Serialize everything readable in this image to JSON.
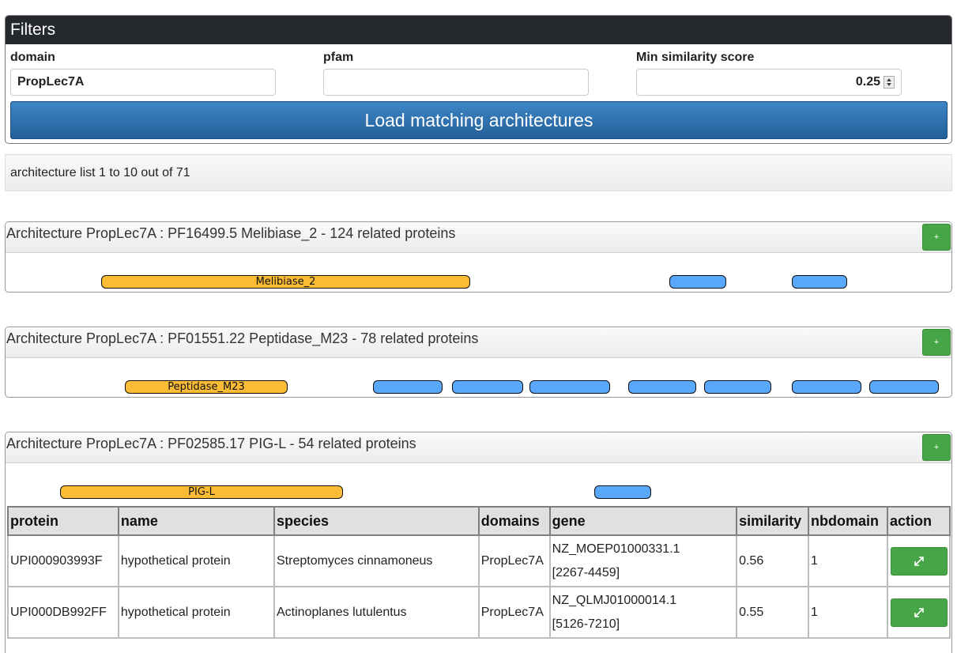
{
  "filters": {
    "title": "Filters",
    "domain": {
      "label": "domain",
      "value": "PropLec7A"
    },
    "pfam": {
      "label": "pfam",
      "value": ""
    },
    "min_similarity": {
      "label": "Min similarity score",
      "value": "0.25"
    },
    "load_button": "Load matching architectures"
  },
  "pager": {
    "text": "architecture list 1 to 10 out of 71"
  },
  "architectures": [
    {
      "title": "Architecture PropLec7A : PF16499.5 Melibiase_2 - 124 related proteins",
      "plus": "+",
      "main_domain": "Melibiase_2"
    },
    {
      "title": "Architecture PropLec7A : PF01551.22 Peptidase_M23 - 78 related proteins",
      "plus": "+",
      "main_domain": "Peptidase_M23"
    },
    {
      "title": "Architecture PropLec7A : PF02585.17 PIG-L - 54 related proteins",
      "plus": "+",
      "main_domain": "PIG-L"
    }
  ],
  "table": {
    "headers": [
      "protein",
      "name",
      "species",
      "domains",
      "gene",
      "similarity",
      "nbdomain",
      "action"
    ],
    "rows": [
      {
        "protein": "UPI000903993F",
        "name": "hypothetical protein",
        "species": "Streptomyces cinnamoneus",
        "domains": "PropLec7A",
        "gene_id": "NZ_MOEP01000331.1",
        "gene_range": "[2267-4459]",
        "similarity": "0.56",
        "nbdomain": "1",
        "action_icon": "expand-icon"
      },
      {
        "protein": "UPI000DB992FF",
        "name": "hypothetical protein",
        "species": "Actinoplanes lutulentus",
        "domains": "PropLec7A",
        "gene_id": "NZ_QLMJ01000014.1",
        "gene_range": "[5126-7210]",
        "similarity": "0.55",
        "nbdomain": "1",
        "action_icon": "expand-icon"
      }
    ]
  },
  "colors": {
    "header_dark": "#25282c",
    "load_button": "#2e6da8",
    "main_domain": "#fbbb35",
    "other_domain": "#5aa8fc",
    "success_button": "#46a546"
  }
}
